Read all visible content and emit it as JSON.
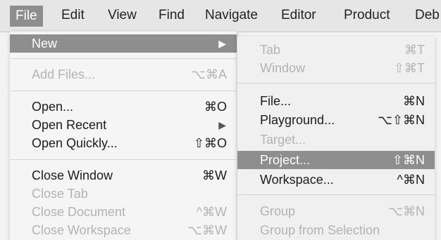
{
  "menubar": {
    "items": [
      "File",
      "Edit",
      "View",
      "Find",
      "Navigate",
      "Editor",
      "Product",
      "Deb"
    ]
  },
  "file_menu": {
    "new": {
      "label": "New"
    },
    "add_files": {
      "label": "Add Files...",
      "shortcut": "⌥⌘A"
    },
    "open": {
      "label": "Open...",
      "shortcut": "⌘O"
    },
    "open_recent": {
      "label": "Open Recent"
    },
    "open_quickly": {
      "label": "Open Quickly...",
      "shortcut": "⇧⌘O"
    },
    "close_window": {
      "label": "Close Window",
      "shortcut": "⌘W"
    },
    "close_tab": {
      "label": "Close Tab"
    },
    "close_document": {
      "label": "Close Document",
      "shortcut": "^⌘W"
    },
    "close_workspace": {
      "label": "Close Workspace",
      "shortcut": "⌥⌘W"
    }
  },
  "new_submenu": {
    "tab": {
      "label": "Tab",
      "shortcut": "⌘T"
    },
    "window": {
      "label": "Window",
      "shortcut": "⇧⌘T"
    },
    "file": {
      "label": "File...",
      "shortcut": "⌘N"
    },
    "playground": {
      "label": "Playground...",
      "shortcut": "⌥⇧⌘N"
    },
    "target": {
      "label": "Target..."
    },
    "project": {
      "label": "Project...",
      "shortcut": "⇧⌘N"
    },
    "workspace": {
      "label": "Workspace...",
      "shortcut": "^⌘N"
    },
    "group": {
      "label": "Group",
      "shortcut": "⌥⌘N"
    },
    "group_from_selection": {
      "label": "Group from Selection"
    }
  }
}
